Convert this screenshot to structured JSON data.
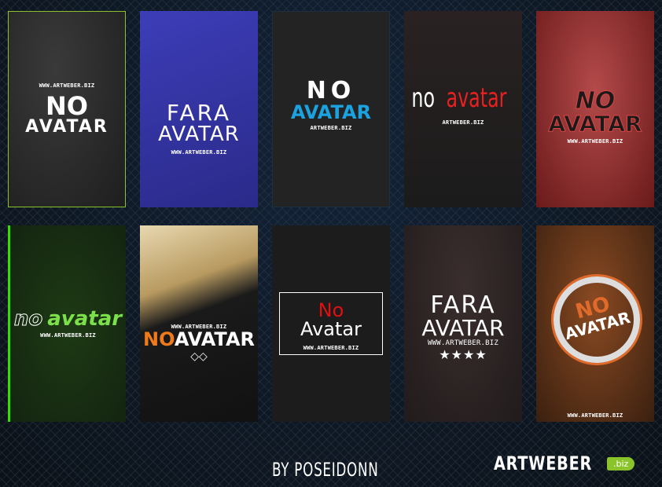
{
  "cards": [
    {
      "line1": "NO",
      "line2": "AVATAR",
      "url": "WWW.ARTWEBER.BIZ",
      "accent": "#8bc32a"
    },
    {
      "line1": "FARA",
      "line2": "AVATAR",
      "url": "WWW.ARTWEBER.BIZ",
      "accent": "#ffffff"
    },
    {
      "line1": "NO",
      "line2": "AVATAR",
      "url": "ARTWEBER.BIZ",
      "accent": "#1aa3e0"
    },
    {
      "line1": "no",
      "line2": "avatar",
      "url": "ARTWEBER.BIZ",
      "accent": "#e82020"
    },
    {
      "line1": "NO",
      "line2": "AVATAR",
      "url": "WWW.ARTWEBER.BIZ",
      "accent": "#1a1a1a"
    },
    {
      "line1": "no",
      "line2": "avatar",
      "url": "WWW.ARTWEBER.BIZ",
      "accent": "#7be04a"
    },
    {
      "line1": "NO",
      "line2": "AVATAR",
      "url": "WWW.ARTWEBER.BIZ",
      "accent": "#f07a1a"
    },
    {
      "line1": "No",
      "line2": "Avatar",
      "url": "WWW.ARTWEBER.BIZ",
      "accent": "#e01010"
    },
    {
      "line1": "FARA",
      "line2": "AVATAR",
      "url": "WWW.ARTWEBER.BIZ",
      "stars": "★★★★",
      "accent": "#ffffff"
    },
    {
      "line1": "NO",
      "line2": "AVATAR",
      "url": "WWW.ARTWEBER.BIZ",
      "accent": "#e06a2a"
    }
  ],
  "footer": {
    "credit": "BY POSEIDONN",
    "logo_text": "ARTWEBER",
    "logo_tag": ".biz",
    "logo_color": "#8bc32a"
  }
}
